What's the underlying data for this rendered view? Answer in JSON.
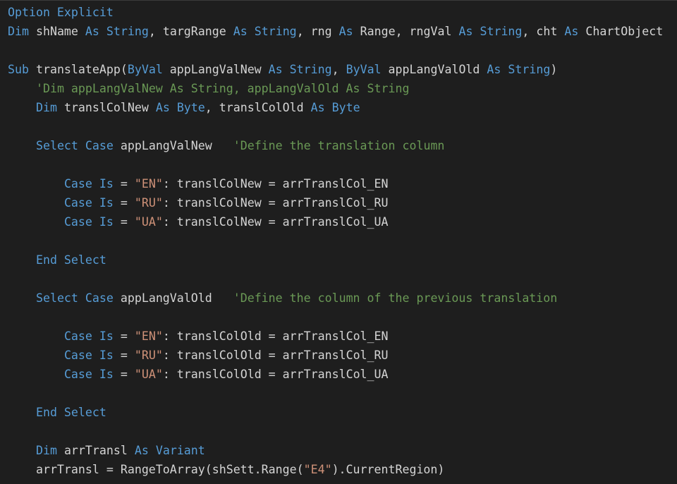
{
  "editor": {
    "language": "VBA",
    "theme_colors": {
      "background": "#1e1e1e",
      "keyword": "#569cd6",
      "identifier": "#d4d4d4",
      "string": "#ce9178",
      "comment": "#6a9955"
    },
    "lines": [
      [
        {
          "t": "kw",
          "v": "Option Explicit"
        }
      ],
      [
        {
          "t": "kw",
          "v": "Dim"
        },
        {
          "t": "id",
          "v": " shName "
        },
        {
          "t": "kw",
          "v": "As"
        },
        {
          "t": "id",
          "v": " "
        },
        {
          "t": "kw",
          "v": "String"
        },
        {
          "t": "id",
          "v": ", targRange "
        },
        {
          "t": "kw",
          "v": "As"
        },
        {
          "t": "id",
          "v": " "
        },
        {
          "t": "kw",
          "v": "String"
        },
        {
          "t": "id",
          "v": ", rng "
        },
        {
          "t": "kw",
          "v": "As"
        },
        {
          "t": "id",
          "v": " Range, rngVal "
        },
        {
          "t": "kw",
          "v": "As"
        },
        {
          "t": "id",
          "v": " "
        },
        {
          "t": "kw",
          "v": "String"
        },
        {
          "t": "id",
          "v": ", cht "
        },
        {
          "t": "kw",
          "v": "As"
        },
        {
          "t": "id",
          "v": " ChartObject"
        }
      ],
      [],
      [
        {
          "t": "kw",
          "v": "Sub"
        },
        {
          "t": "id",
          "v": " translateApp("
        },
        {
          "t": "kw",
          "v": "ByVal"
        },
        {
          "t": "id",
          "v": " appLangValNew "
        },
        {
          "t": "kw",
          "v": "As"
        },
        {
          "t": "id",
          "v": " "
        },
        {
          "t": "kw",
          "v": "String"
        },
        {
          "t": "id",
          "v": ", "
        },
        {
          "t": "kw",
          "v": "ByVal"
        },
        {
          "t": "id",
          "v": " appLangValOld "
        },
        {
          "t": "kw",
          "v": "As"
        },
        {
          "t": "id",
          "v": " "
        },
        {
          "t": "kw",
          "v": "String"
        },
        {
          "t": "id",
          "v": ")"
        }
      ],
      [
        {
          "t": "id",
          "v": "    "
        },
        {
          "t": "cmt",
          "v": "'Dim appLangValNew As String, appLangValOld As String"
        }
      ],
      [
        {
          "t": "id",
          "v": "    "
        },
        {
          "t": "kw",
          "v": "Dim"
        },
        {
          "t": "id",
          "v": " translColNew "
        },
        {
          "t": "kw",
          "v": "As"
        },
        {
          "t": "id",
          "v": " "
        },
        {
          "t": "kw",
          "v": "Byte"
        },
        {
          "t": "id",
          "v": ", translColOld "
        },
        {
          "t": "kw",
          "v": "As"
        },
        {
          "t": "id",
          "v": " "
        },
        {
          "t": "kw",
          "v": "Byte"
        }
      ],
      [],
      [
        {
          "t": "id",
          "v": "    "
        },
        {
          "t": "kw",
          "v": "Select Case"
        },
        {
          "t": "id",
          "v": " appLangValNew   "
        },
        {
          "t": "cmt",
          "v": "'Define the translation column"
        }
      ],
      [],
      [
        {
          "t": "id",
          "v": "        "
        },
        {
          "t": "kw",
          "v": "Case Is"
        },
        {
          "t": "id",
          "v": " = "
        },
        {
          "t": "str",
          "v": "\"EN\""
        },
        {
          "t": "id",
          "v": ": translColNew = arrTranslCol_EN"
        }
      ],
      [
        {
          "t": "id",
          "v": "        "
        },
        {
          "t": "kw",
          "v": "Case Is"
        },
        {
          "t": "id",
          "v": " = "
        },
        {
          "t": "str",
          "v": "\"RU\""
        },
        {
          "t": "id",
          "v": ": translColNew = arrTranslCol_RU"
        }
      ],
      [
        {
          "t": "id",
          "v": "        "
        },
        {
          "t": "kw",
          "v": "Case Is"
        },
        {
          "t": "id",
          "v": " = "
        },
        {
          "t": "str",
          "v": "\"UA\""
        },
        {
          "t": "id",
          "v": ": translColNew = arrTranslCol_UA"
        }
      ],
      [],
      [
        {
          "t": "id",
          "v": "    "
        },
        {
          "t": "kw",
          "v": "End Select"
        }
      ],
      [],
      [
        {
          "t": "id",
          "v": "    "
        },
        {
          "t": "kw",
          "v": "Select Case"
        },
        {
          "t": "id",
          "v": " appLangValOld   "
        },
        {
          "t": "cmt",
          "v": "'Define the column of the previous translation"
        }
      ],
      [],
      [
        {
          "t": "id",
          "v": "        "
        },
        {
          "t": "kw",
          "v": "Case Is"
        },
        {
          "t": "id",
          "v": " = "
        },
        {
          "t": "str",
          "v": "\"EN\""
        },
        {
          "t": "id",
          "v": ": translColOld = arrTranslCol_EN"
        }
      ],
      [
        {
          "t": "id",
          "v": "        "
        },
        {
          "t": "kw",
          "v": "Case Is"
        },
        {
          "t": "id",
          "v": " = "
        },
        {
          "t": "str",
          "v": "\"RU\""
        },
        {
          "t": "id",
          "v": ": translColOld = arrTranslCol_RU"
        }
      ],
      [
        {
          "t": "id",
          "v": "        "
        },
        {
          "t": "kw",
          "v": "Case Is"
        },
        {
          "t": "id",
          "v": " = "
        },
        {
          "t": "str",
          "v": "\"UA\""
        },
        {
          "t": "id",
          "v": ": translColOld = arrTranslCol_UA"
        }
      ],
      [],
      [
        {
          "t": "id",
          "v": "    "
        },
        {
          "t": "kw",
          "v": "End Select"
        }
      ],
      [],
      [
        {
          "t": "id",
          "v": "    "
        },
        {
          "t": "kw",
          "v": "Dim"
        },
        {
          "t": "id",
          "v": " arrTransl "
        },
        {
          "t": "kw",
          "v": "As"
        },
        {
          "t": "id",
          "v": " "
        },
        {
          "t": "kw",
          "v": "Variant"
        }
      ],
      [
        {
          "t": "id",
          "v": "    arrTransl = RangeToArray(shSett.Range("
        },
        {
          "t": "str",
          "v": "\"E4\""
        },
        {
          "t": "id",
          "v": ").CurrentRegion)"
        }
      ]
    ]
  }
}
